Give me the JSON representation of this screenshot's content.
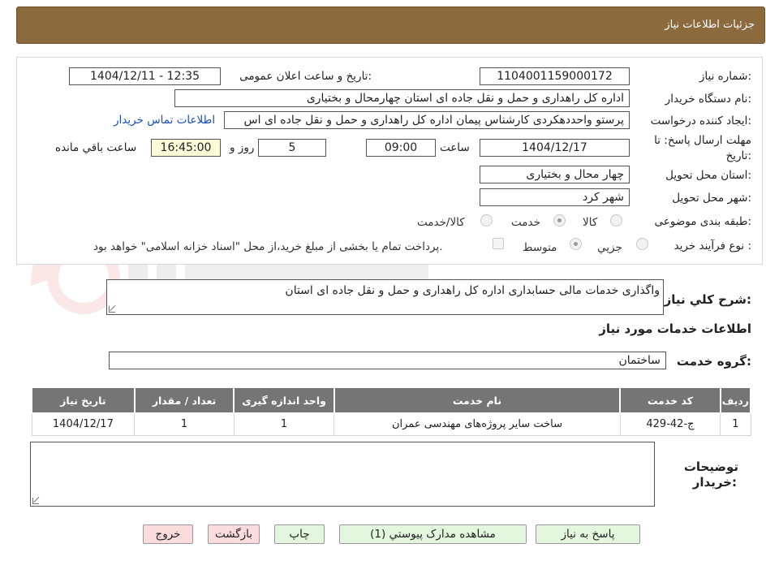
{
  "page_title": "جزئیات اطلاعات نیاز",
  "labels": {
    "need_number": "شماره نیاز:",
    "announce_datetime": "تاریخ و ساعت اعلان عمومی:",
    "buyer_org": "نام دستگاه خریدار:",
    "requester": "ایجاد کننده درخواست:",
    "deadline_line1": "مهلت ارسال پاسخ: تا",
    "deadline_line2": "تاریخ:",
    "time_word": "ساعت",
    "days_and": "روز و",
    "remaining": "ساعت باقي مانده",
    "province": "استان محل تحویل:",
    "city": "شهر محل تحویل:",
    "category": "طبقه بندی موضوعی:",
    "process": "نوع فرآیند خرید :",
    "description": "شرح کلي نیاز:",
    "services_info": "اطلاعات خدمات مورد نیاز",
    "service_group": "گروه خدمت:",
    "buyer_notes_line1": "توضیحات",
    "buyer_notes_line2": "خریدار:"
  },
  "fields": {
    "need_number": "1104001159000172",
    "announce_datetime": "1404/12/11 - 12:35",
    "buyer_org": "اداره کل راهداری و حمل و نقل جاده ای استان چهارمحال و بختیاری",
    "requester": "پرستو واحددهکردی کارشناس پیمان اداره کل راهداری و حمل و نقل جاده ای اس",
    "contact_link": "اطلاعات تماس خریدار",
    "deadline_date": "1404/12/17",
    "deadline_time": "09:00",
    "days_remaining": "5",
    "time_remaining": "16:45:00",
    "province": "چهار محال و بختیاری",
    "city": "شهر کرد",
    "description": "واگذاری خدمات مالی حسابداری اداره کل راهداری و حمل و نقل جاده ای استان",
    "service_group": "ساختمان",
    "buyer_notes": ""
  },
  "category_options": [
    {
      "label": "کالا",
      "selected": false
    },
    {
      "label": "خدمت",
      "selected": true
    },
    {
      "label": "کالا/خدمت",
      "selected": false
    }
  ],
  "process_options": [
    {
      "label": "جزيي",
      "selected": false
    },
    {
      "label": "متوسط",
      "selected": true
    }
  ],
  "payment_note": "پرداخت تمام یا بخشی از مبلغ خرید،از محل \"اسناد خزانه اسلامی\" خواهد بود.",
  "table": {
    "headers": [
      "ردیف",
      "کد خدمت",
      "نام خدمت",
      "واحد اندازه گیری",
      "تعداد / مقدار",
      "تاریخ نیاز"
    ],
    "rows": [
      [
        "1",
        "ج-42-429",
        "ساخت سایر پروژه‌های مهندسی عمران",
        "1",
        "1",
        "1404/12/17"
      ]
    ]
  },
  "buttons": {
    "reply": "پاسخ به نیاز",
    "attachments": "مشاهده مدارک پیوستي (1)",
    "print": "چاپ",
    "back": "بازگشت",
    "exit": "خروج"
  },
  "colors": {
    "header_bg": "#8b6a3e",
    "table_header_bg": "#757575",
    "highlight_field": "#fefbd9",
    "green_button": "#e3f7de",
    "pink_button": "#fbdcdc",
    "link": "#1a4fb5"
  }
}
